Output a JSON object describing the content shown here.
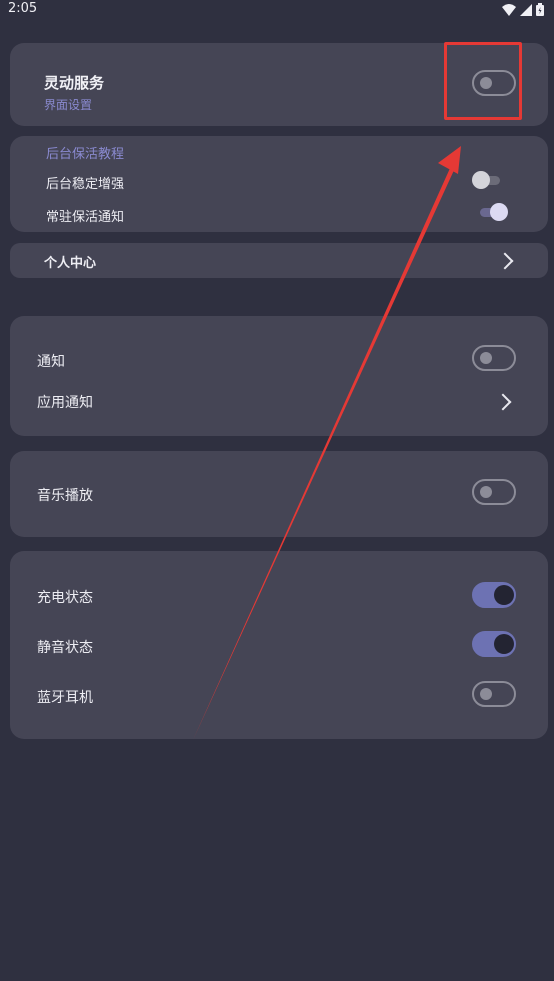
{
  "status_bar": {
    "time": "2:05",
    "icons": [
      "wifi-icon",
      "signal-icon",
      "battery-icon"
    ]
  },
  "service": {
    "title": "灵动服务",
    "subtitle": "界面设置",
    "enabled": false
  },
  "keepalive": {
    "tutorial_link": "后台保活教程",
    "items": [
      {
        "label": "后台稳定增强",
        "enabled": false
      },
      {
        "label": "常驻保活通知",
        "enabled": true
      }
    ]
  },
  "personal_center": {
    "label": "个人中心"
  },
  "notifications": {
    "notify_label": "通知",
    "notify_enabled": false,
    "app_notify_label": "应用通知"
  },
  "music": {
    "label": "音乐播放",
    "enabled": false
  },
  "states": {
    "items": [
      {
        "label": "充电状态",
        "enabled": true
      },
      {
        "label": "静音状态",
        "enabled": true
      },
      {
        "label": "蓝牙耳机",
        "enabled": false
      }
    ]
  },
  "colors": {
    "background": "#2f3040",
    "card": "#454555",
    "accent": "#6d72b3",
    "annotation": "#e53935"
  }
}
